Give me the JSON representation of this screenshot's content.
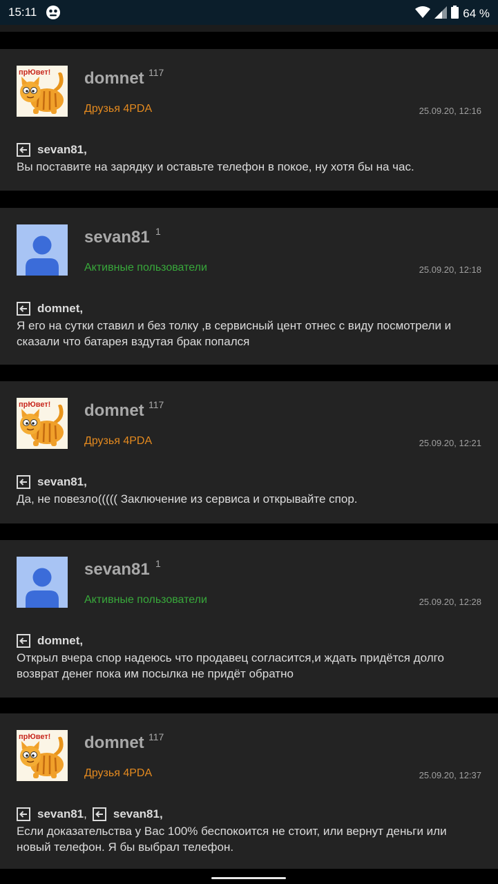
{
  "status_bar": {
    "time": "15:11",
    "battery": "64 %",
    "icons": [
      "smiley-app-icon",
      "wifi-icon",
      "signal-icon",
      "battery-icon"
    ]
  },
  "colors": {
    "friends_group": "#e48a1f",
    "active_group": "#38a93b",
    "background": "#232323",
    "separator": "#000000"
  },
  "posts": [
    {
      "author": "domnet",
      "reputation": "117",
      "group": "Друзья 4PDA",
      "group_type": "friends",
      "date": "25.09.20, 12:16",
      "avatar": "cat",
      "reply_to": [
        "sevan81"
      ],
      "text": "Вы поставите на зарядку и оставьте телефон в покое, ну хотя бы на час."
    },
    {
      "author": "sevan81",
      "reputation": "1",
      "group": "Активные пользователи",
      "group_type": "active",
      "date": "25.09.20, 12:18",
      "avatar": "default",
      "reply_to": [
        "domnet"
      ],
      "text": "Я его на сутки ставил и без толку ,в сервисный цент отнес с виду посмотрели и сказали что батарея вздутая брак попался"
    },
    {
      "author": "domnet",
      "reputation": "117",
      "group": "Друзья 4PDA",
      "group_type": "friends",
      "date": "25.09.20, 12:21",
      "avatar": "cat",
      "reply_to": [
        "sevan81"
      ],
      "text": "Да, не повезло((((( Заключение из сервиса и открывайте спор."
    },
    {
      "author": "sevan81",
      "reputation": "1",
      "group": "Активные пользователи",
      "group_type": "active",
      "date": "25.09.20, 12:28",
      "avatar": "default",
      "reply_to": [
        "domnet"
      ],
      "text": "Открыл вчера спор надеюсь что продавец согласится,и ждать придётся долго возврат денег пока им посылка не придёт обратно"
    },
    {
      "author": "domnet",
      "reputation": "117",
      "group": "Друзья 4PDA",
      "group_type": "friends",
      "date": "25.09.20, 12:37",
      "avatar": "cat",
      "reply_to": [
        "sevan81",
        "sevan81"
      ],
      "text": "Если доказательства у Вас 100% беспокоится не стоит, или вернут деньги или новый телефон. Я бы выбрал телефон."
    }
  ]
}
